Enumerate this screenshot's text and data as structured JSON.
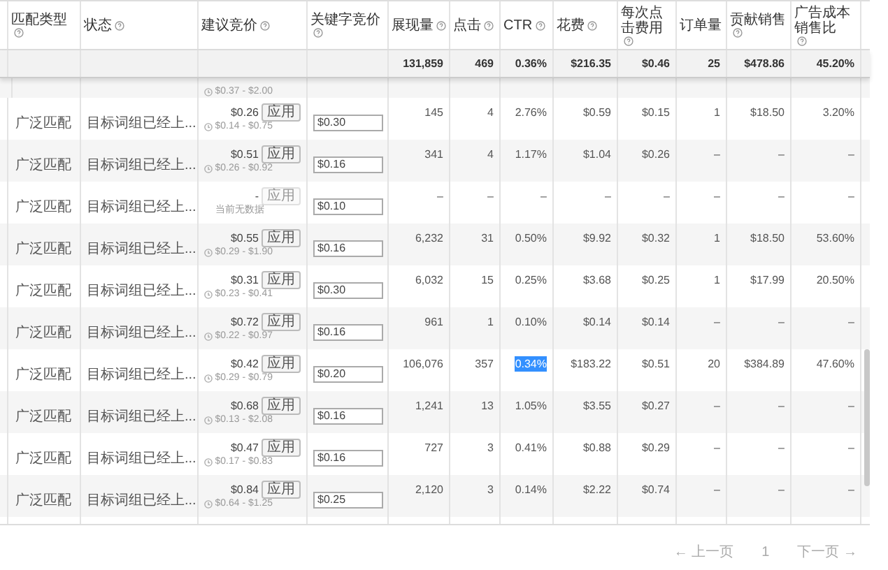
{
  "columns": [
    {
      "label": "匹配类型",
      "info": true
    },
    {
      "label": "状态",
      "info": true
    },
    {
      "label": "建议竞价",
      "info": true
    },
    {
      "label": "关键字竞价",
      "info": true
    },
    {
      "label": "展现量",
      "info": true
    },
    {
      "label": "点击",
      "info": true
    },
    {
      "label": "CTR",
      "info": true
    },
    {
      "label": "花费",
      "info": true
    },
    {
      "label": "每次点击费用",
      "info": true
    },
    {
      "label": "订单量",
      "info": false
    },
    {
      "label": "贡献销售",
      "info": true
    },
    {
      "label": "广告成本销售比",
      "info": true
    }
  ],
  "totals": {
    "impressions": "131,859",
    "clicks": "469",
    "ctr": "0.36%",
    "spend": "$216.35",
    "cpc": "$0.46",
    "orders": "25",
    "sales": "$478.86",
    "acos": "45.20%"
  },
  "partial_row": {
    "bid_range": "$0.37 - $2.00"
  },
  "rows": [
    {
      "match_type": "广泛匹配",
      "status": "目标词组已经上...",
      "suggested_bid": "$0.26",
      "apply_button": {
        "label": "应用",
        "disabled": false
      },
      "bid_range": "$0.14 - $0.75",
      "keyword_bid": "$0.30",
      "impressions": "145",
      "clicks": "4",
      "ctr": "2.76%",
      "ctr_highlighted": false,
      "spend": "$0.59",
      "cpc": "$0.15",
      "orders": "1",
      "sales": "$18.50",
      "acos": "3.20%"
    },
    {
      "match_type": "广泛匹配",
      "status": "目标词组已经上...",
      "suggested_bid": "$0.51",
      "apply_button": {
        "label": "应用",
        "disabled": false
      },
      "bid_range": "$0.26 - $0.92",
      "keyword_bid": "$0.16",
      "impressions": "341",
      "clicks": "4",
      "ctr": "1.17%",
      "ctr_highlighted": false,
      "spend": "$1.04",
      "cpc": "$0.26",
      "orders": "–",
      "sales": "–",
      "acos": "–"
    },
    {
      "match_type": "广泛匹配",
      "status": "目标词组已经上...",
      "suggested_bid": "-",
      "apply_button": {
        "label": "应用",
        "disabled": true
      },
      "note": "当前无数据",
      "keyword_bid": "$0.10",
      "impressions": "–",
      "clicks": "–",
      "ctr": "–",
      "ctr_highlighted": false,
      "spend": "–",
      "cpc": "–",
      "orders": "–",
      "sales": "–",
      "acos": "–"
    },
    {
      "match_type": "广泛匹配",
      "status": "目标词组已经上...",
      "suggested_bid": "$0.55",
      "apply_button": {
        "label": "应用",
        "disabled": false
      },
      "bid_range": "$0.29 - $1.90",
      "keyword_bid": "$0.16",
      "impressions": "6,232",
      "clicks": "31",
      "ctr": "0.50%",
      "ctr_highlighted": false,
      "spend": "$9.92",
      "cpc": "$0.32",
      "orders": "1",
      "sales": "$18.50",
      "acos": "53.60%"
    },
    {
      "match_type": "广泛匹配",
      "status": "目标词组已经上...",
      "suggested_bid": "$0.31",
      "apply_button": {
        "label": "应用",
        "disabled": false
      },
      "bid_range": "$0.23 - $0.41",
      "keyword_bid": "$0.30",
      "impressions": "6,032",
      "clicks": "15",
      "ctr": "0.25%",
      "ctr_highlighted": false,
      "spend": "$3.68",
      "cpc": "$0.25",
      "orders": "1",
      "sales": "$17.99",
      "acos": "20.50%"
    },
    {
      "match_type": "广泛匹配",
      "status": "目标词组已经上...",
      "suggested_bid": "$0.72",
      "apply_button": {
        "label": "应用",
        "disabled": false
      },
      "bid_range": "$0.22 - $0.97",
      "keyword_bid": "$0.16",
      "impressions": "961",
      "clicks": "1",
      "ctr": "0.10%",
      "ctr_highlighted": false,
      "spend": "$0.14",
      "cpc": "$0.14",
      "orders": "–",
      "sales": "–",
      "acos": "–"
    },
    {
      "match_type": "广泛匹配",
      "status": "目标词组已经上...",
      "suggested_bid": "$0.42",
      "apply_button": {
        "label": "应用",
        "disabled": false
      },
      "bid_range": "$0.29 - $0.79",
      "keyword_bid": "$0.20",
      "impressions": "106,076",
      "clicks": "357",
      "ctr": "0.34%",
      "ctr_highlighted": true,
      "spend": "$183.22",
      "cpc": "$0.51",
      "orders": "20",
      "sales": "$384.89",
      "acos": "47.60%"
    },
    {
      "match_type": "广泛匹配",
      "status": "目标词组已经上...",
      "suggested_bid": "$0.68",
      "apply_button": {
        "label": "应用",
        "disabled": false
      },
      "bid_range": "$0.13 - $2.08",
      "keyword_bid": "$0.16",
      "impressions": "1,241",
      "clicks": "13",
      "ctr": "1.05%",
      "ctr_highlighted": false,
      "spend": "$3.55",
      "cpc": "$0.27",
      "orders": "–",
      "sales": "–",
      "acos": "–"
    },
    {
      "match_type": "广泛匹配",
      "status": "目标词组已经上...",
      "suggested_bid": "$0.47",
      "apply_button": {
        "label": "应用",
        "disabled": false
      },
      "bid_range": "$0.17 - $0.83",
      "keyword_bid": "$0.16",
      "impressions": "727",
      "clicks": "3",
      "ctr": "0.41%",
      "ctr_highlighted": false,
      "spend": "$0.88",
      "cpc": "$0.29",
      "orders": "–",
      "sales": "–",
      "acos": "–"
    },
    {
      "match_type": "广泛匹配",
      "status": "目标词组已经上...",
      "suggested_bid": "$0.84",
      "apply_button": {
        "label": "应用",
        "disabled": false
      },
      "bid_range": "$0.64 - $1.25",
      "keyword_bid": "$0.25",
      "impressions": "2,120",
      "clicks": "3",
      "ctr": "0.14%",
      "ctr_highlighted": false,
      "spend": "$2.22",
      "cpc": "$0.74",
      "orders": "–",
      "sales": "–",
      "acos": "–"
    }
  ],
  "pagination": {
    "previous": "← 上一页",
    "page": "1",
    "next": "下一页 →"
  }
}
